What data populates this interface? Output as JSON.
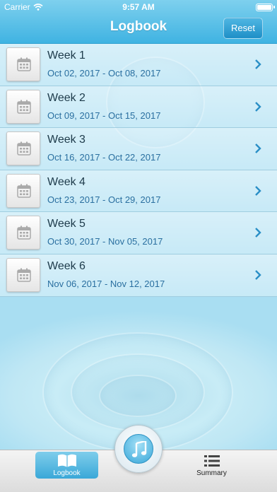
{
  "status_bar": {
    "carrier": "Carrier",
    "time": "9:57 AM"
  },
  "nav": {
    "title": "Logbook",
    "reset_label": "Reset"
  },
  "weeks": [
    {
      "label": "Week 1",
      "dates": "Oct 02, 2017 - Oct 08, 2017"
    },
    {
      "label": "Week 2",
      "dates": "Oct 09, 2017 - Oct 15, 2017"
    },
    {
      "label": "Week 3",
      "dates": "Oct 16, 2017 - Oct 22, 2017"
    },
    {
      "label": "Week 4",
      "dates": "Oct 23, 2017 - Oct 29, 2017"
    },
    {
      "label": "Week 5",
      "dates": "Oct 30, 2017 - Nov 05, 2017"
    },
    {
      "label": "Week 6",
      "dates": "Nov 06, 2017 - Nov 12, 2017"
    }
  ],
  "tabs": {
    "logbook_label": "Logbook",
    "summary_label": "Summary"
  },
  "icons": {
    "row_icon": "calendar-icon",
    "row_accessory": "chevron-right-icon",
    "logbook_tab": "book-icon",
    "summary_tab": "list-icon",
    "center_button": "music-note-icon"
  },
  "colors": {
    "nav_bar": "#3fb3e2",
    "accent": "#2a6fa0",
    "background": "#b5e3f3"
  }
}
